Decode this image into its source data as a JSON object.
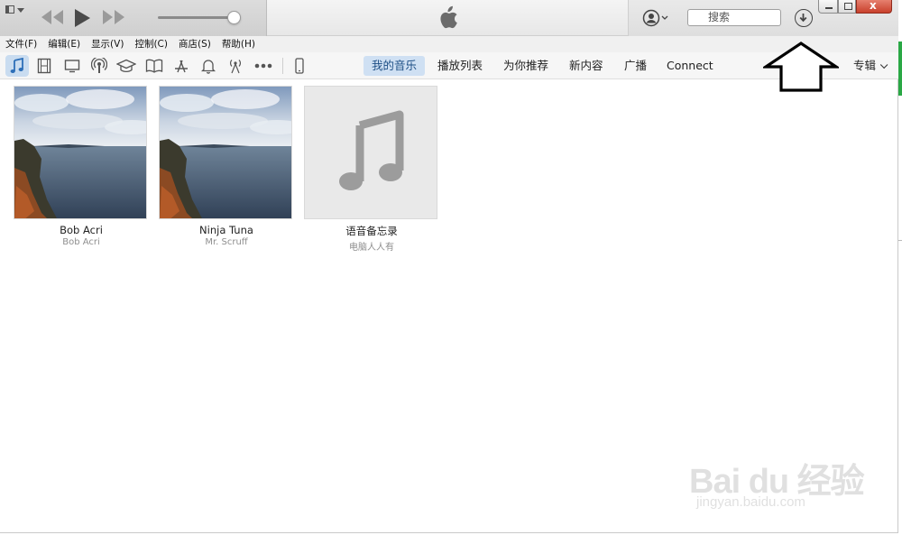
{
  "window": {
    "search_placeholder": "搜索",
    "close_glyph": "x"
  },
  "menu": [
    "文件(F)",
    "编辑(E)",
    "显示(V)",
    "控制(C)",
    "商店(S)",
    "帮助(H)"
  ],
  "media_types": [
    {
      "name": "music-icon",
      "active": true
    },
    {
      "name": "movies-icon",
      "active": false
    },
    {
      "name": "tv-icon",
      "active": false
    },
    {
      "name": "podcasts-icon",
      "active": false
    },
    {
      "name": "itunes-u-icon",
      "active": false
    },
    {
      "name": "books-icon",
      "active": false
    },
    {
      "name": "apps-icon",
      "active": false
    },
    {
      "name": "tones-icon",
      "active": false
    },
    {
      "name": "radio-icon",
      "active": false
    },
    {
      "name": "more-icon",
      "active": false
    },
    {
      "name": "device-icon",
      "active": false
    }
  ],
  "tabs": [
    {
      "label": "我的音乐",
      "active": true
    },
    {
      "label": "播放列表",
      "active": false
    },
    {
      "label": "为你推荐",
      "active": false
    },
    {
      "label": "新内容",
      "active": false
    },
    {
      "label": "广播",
      "active": false
    },
    {
      "label": "Connect",
      "active": false
    }
  ],
  "sort_label": "专辑",
  "albums": [
    {
      "title": "Bob Acri",
      "artist": "Bob Acri",
      "cover": "landscape"
    },
    {
      "title": "Ninja Tuna",
      "artist": "Mr. Scruff",
      "cover": "landscape"
    },
    {
      "title": "语音备忘录",
      "artist": "电脑人人有",
      "cover": "music-note"
    }
  ],
  "watermark": {
    "main": "Bai du 经验",
    "sub": "jingyan.baidu.com"
  },
  "colors": {
    "accent_tab": "#cfe0f3",
    "close_button": "#c8402c"
  }
}
